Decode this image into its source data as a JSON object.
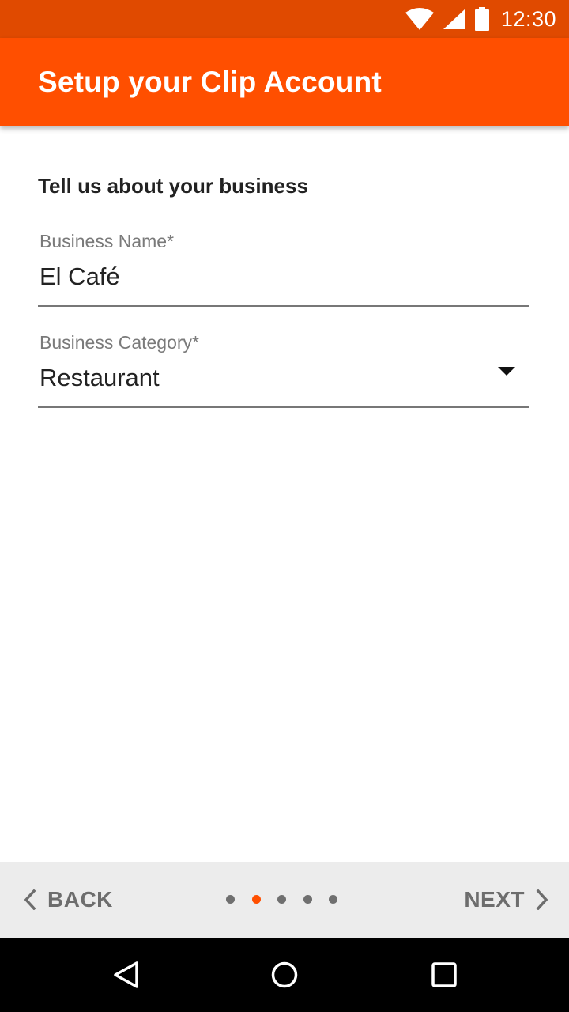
{
  "status_bar": {
    "time": "12:30",
    "icons": [
      "wifi-icon",
      "signal-icon",
      "battery-icon"
    ]
  },
  "app_bar": {
    "title": "Setup your Clip Account"
  },
  "form": {
    "heading": "Tell us about your business",
    "business_name": {
      "label": "Business Name*",
      "value": "El Café"
    },
    "business_category": {
      "label": "Business Category*",
      "value": "Restaurant"
    }
  },
  "bottom_nav": {
    "back_label": "BACK",
    "next_label": "NEXT",
    "page_count": 5,
    "active_page": 2
  },
  "colors": {
    "status_bar": "#e04a00",
    "app_bar": "#ff4f00",
    "accent": "#ff4f00",
    "nav_background": "#ececec"
  }
}
